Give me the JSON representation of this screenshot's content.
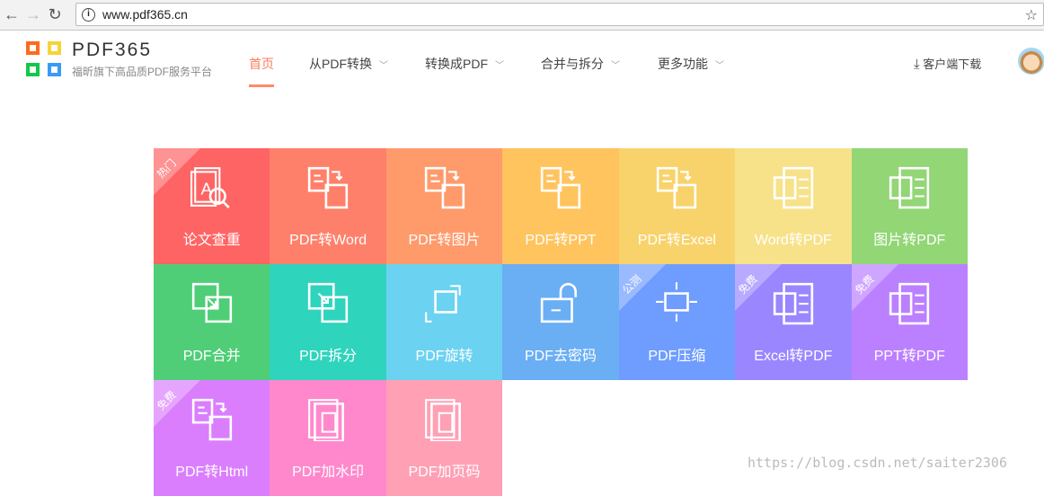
{
  "browser": {
    "url": "www.pdf365.cn"
  },
  "header": {
    "brand": "PDF365",
    "slogan": "福昕旗下高品质PDF服务平台",
    "download": "客户端下载",
    "logo_colors": [
      "#ff6a1a",
      "#f7d33a",
      "#12c84a",
      "#3a9bf5"
    ],
    "nav": [
      {
        "label": "首页",
        "active": true
      },
      {
        "label": "从PDF转换",
        "dropdown": true
      },
      {
        "label": "转换成PDF",
        "dropdown": true
      },
      {
        "label": "合并与拆分",
        "dropdown": true
      },
      {
        "label": "更多功能",
        "dropdown": true
      }
    ]
  },
  "tools": [
    {
      "label": "论文查重",
      "color": "#ff6464",
      "badge": "热门",
      "icon": "search-doc"
    },
    {
      "label": "PDF转Word",
      "color": "#ff806a",
      "icon": "convert"
    },
    {
      "label": "PDF转图片",
      "color": "#ff9a6b",
      "icon": "convert"
    },
    {
      "label": "PDF转PPT",
      "color": "#ffc45e",
      "icon": "convert"
    },
    {
      "label": "PDF转Excel",
      "color": "#f8d36b",
      "icon": "convert"
    },
    {
      "label": "Word转PDF",
      "color": "#f7e28a",
      "icon": "doc"
    },
    {
      "label": "图片转PDF",
      "color": "#92d676",
      "icon": "doc"
    },
    {
      "label": "PDF合并",
      "color": "#4fce77",
      "icon": "merge"
    },
    {
      "label": "PDF拆分",
      "color": "#2fd4bd",
      "icon": "split"
    },
    {
      "label": "PDF旋转",
      "color": "#6cd2f1",
      "icon": "rotate"
    },
    {
      "label": "PDF去密码",
      "color": "#6aaef4",
      "icon": "unlock"
    },
    {
      "label": "PDF压缩",
      "color": "#6f9cff",
      "badge": "公测",
      "icon": "compress"
    },
    {
      "label": "Excel转PDF",
      "color": "#9a86ff",
      "badge": "免费",
      "icon": "doc"
    },
    {
      "label": "PPT转PDF",
      "color": "#bb80ff",
      "badge": "免费",
      "icon": "doc"
    },
    {
      "label": "PDF转Html",
      "color": "#da7efe",
      "badge": "免费",
      "icon": "convert"
    },
    {
      "label": "PDF加水印",
      "color": "#ff88cc",
      "icon": "stack"
    },
    {
      "label": "PDF加页码",
      "color": "#ffa0b5",
      "icon": "stack"
    }
  ],
  "watermark": "https://blog.csdn.net/saiter2306"
}
